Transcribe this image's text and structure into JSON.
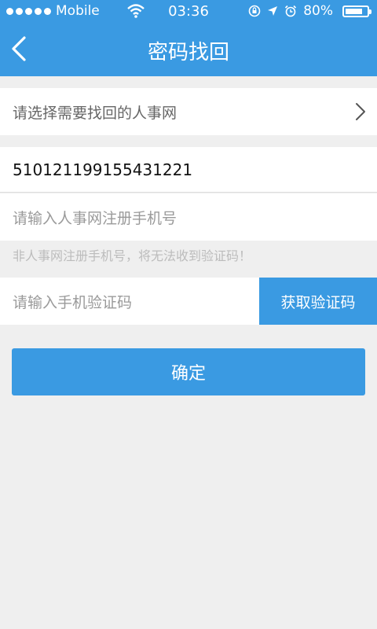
{
  "status": {
    "carrier": "Mobile",
    "time": "03:36",
    "battery_label": "80%",
    "battery_level": 0.8
  },
  "header": {
    "title": "密码找回"
  },
  "form": {
    "select_placeholder": "请选择需要找回的人事网",
    "id_value": "510121199155431221",
    "phone_placeholder": "请输入人事网注册手机号",
    "hint": "非人事网注册手机号，将无法收到验证码！",
    "code_placeholder": "请输入手机验证码",
    "get_code_label": "获取验证码",
    "confirm_label": "确定"
  },
  "colors": {
    "accent": "#3a9ae2",
    "background": "#efefef"
  }
}
